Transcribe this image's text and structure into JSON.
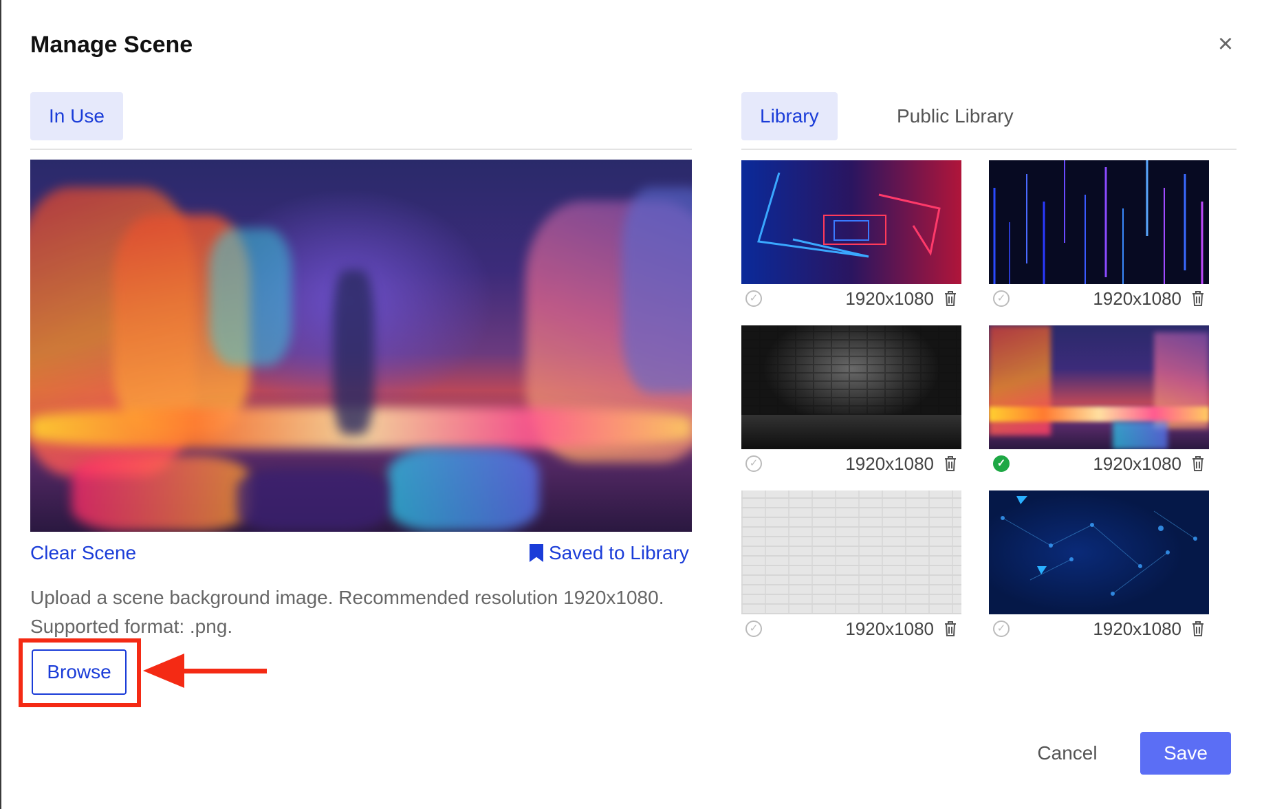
{
  "dialog": {
    "title": "Manage Scene",
    "close_icon": "close-icon"
  },
  "left": {
    "tab_in_use": "In Use",
    "clear_scene": "Clear Scene",
    "saved_to_library": "Saved to Library",
    "hint_line1": "Upload a scene background image. Recommended resolution 1920x1080.",
    "hint_line2": "Supported format: .png.",
    "browse_label": "Browse"
  },
  "right": {
    "tab_library": "Library",
    "tab_public_library": "Public Library",
    "thumbnails": [
      {
        "resolution": "1920x1080",
        "selected": false,
        "theme": "neon-tunnel"
      },
      {
        "resolution": "1920x1080",
        "selected": false,
        "theme": "neon-lines"
      },
      {
        "resolution": "1920x1080",
        "selected": false,
        "theme": "dark-brick"
      },
      {
        "resolution": "1920x1080",
        "selected": true,
        "theme": "city-lights"
      },
      {
        "resolution": "1920x1080",
        "selected": false,
        "theme": "white-brick"
      },
      {
        "resolution": "1920x1080",
        "selected": false,
        "theme": "blue-tech"
      }
    ]
  },
  "footer": {
    "cancel_label": "Cancel",
    "save_label": "Save"
  },
  "colors": {
    "accent": "#1a3cd8",
    "save_button": "#5b6ef5",
    "tab_active_bg": "#e6e9fb",
    "annotation": "#f42a14",
    "selected_check": "#1ea845"
  }
}
